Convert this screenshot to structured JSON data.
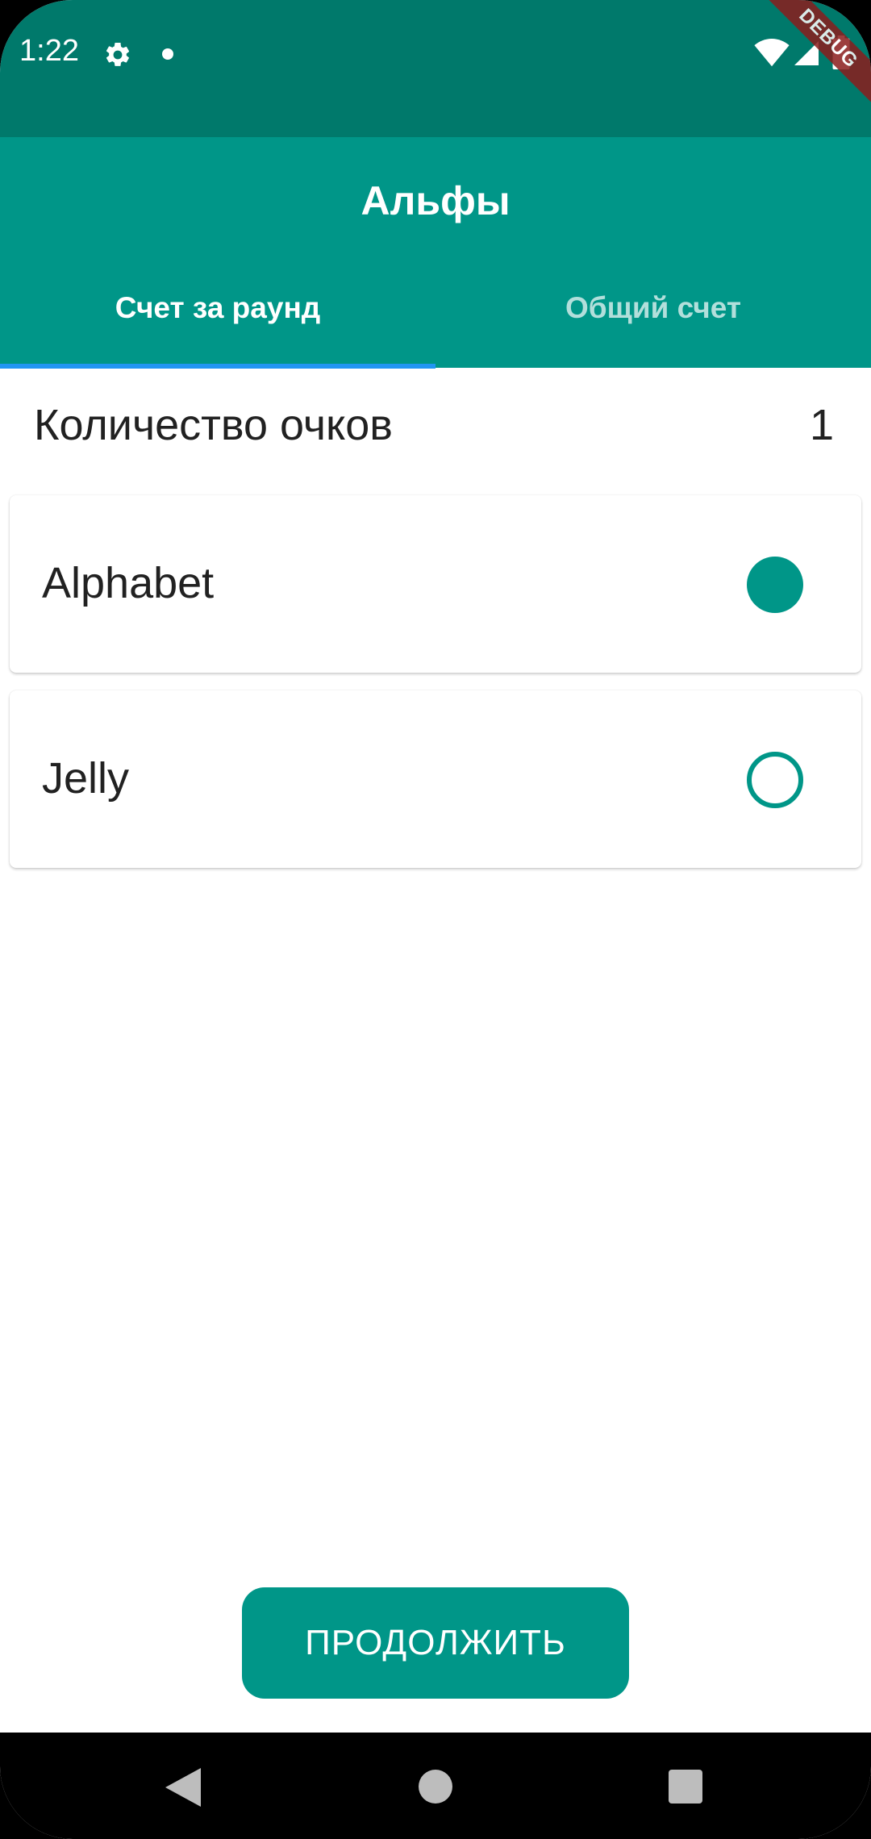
{
  "status_bar": {
    "time": "1:22",
    "icons": [
      "gear-icon",
      "notification-dot-icon",
      "wifi-icon",
      "signal-icon",
      "battery-icon"
    ],
    "debug_label": "DEBUG"
  },
  "app_bar": {
    "title": "Альфы",
    "tabs": [
      {
        "label": "Счет за раунд",
        "selected": true
      },
      {
        "label": "Общий счет",
        "selected": false
      }
    ]
  },
  "main": {
    "points_label": "Количество очков",
    "points_value": "1",
    "options": [
      {
        "label": "Alphabet",
        "selected": true
      },
      {
        "label": "Jelly",
        "selected": false
      }
    ],
    "continue_label": "ПРОДОЛЖИТЬ"
  },
  "colors": {
    "status_bar": "#00796b",
    "primary": "#009688",
    "tab_indicator": "#2196f3"
  },
  "nav_bar": {
    "icons": [
      "back-icon",
      "home-icon",
      "recents-icon"
    ]
  }
}
